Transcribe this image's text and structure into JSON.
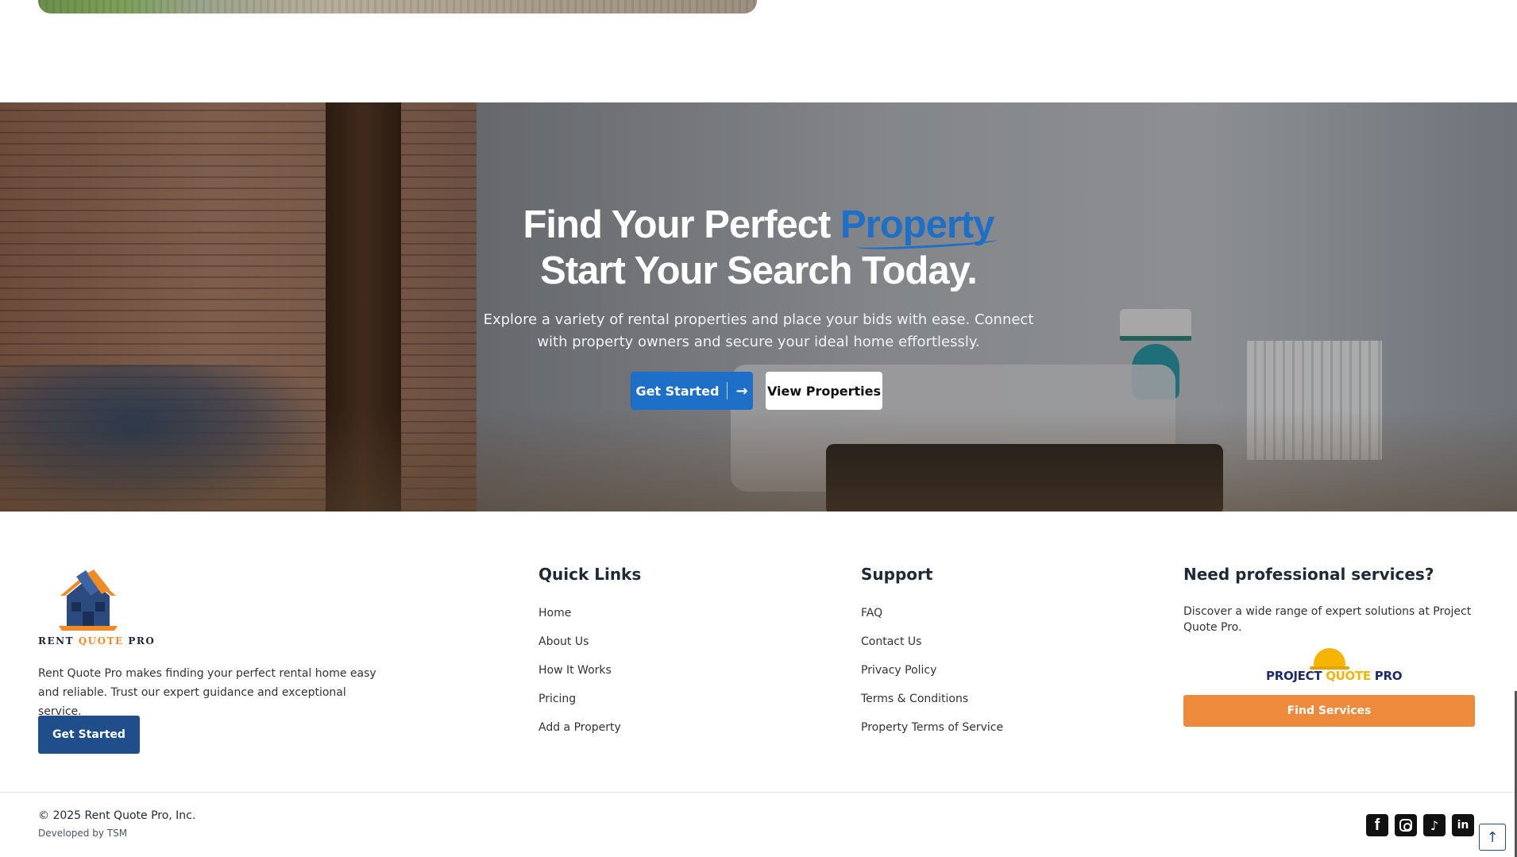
{
  "hero": {
    "title_part1": "Find Your Perfect ",
    "title_accent": "Property",
    "title_line2": "Start Your Search Today.",
    "description": "Explore a variety of rental properties and place your bids with ease. Connect with property owners and secure your ideal home effortlessly.",
    "primary_button": "Get Started",
    "primary_icon": "→",
    "secondary_button": "View Properties"
  },
  "footer": {
    "brand_part1": "RENT ",
    "brand_part2": "QUOTE",
    "brand_part3": " PRO",
    "about": "Rent Quote Pro makes finding your perfect rental home easy and reliable. Trust our expert guidance and exceptional service.",
    "cta": "Get Started",
    "quick_links": {
      "heading": "Quick Links",
      "items": [
        "Home",
        "About Us",
        "How It Works",
        "Pricing",
        "Add a Property"
      ]
    },
    "support": {
      "heading": "Support",
      "items": [
        "FAQ",
        "Contact Us",
        "Privacy Policy",
        "Terms & Conditions",
        "Property Terms of Service"
      ]
    },
    "services": {
      "heading": "Need professional services?",
      "text": "Discover a wide range of expert solutions at Project Quote Pro.",
      "logo_part1": "PROJECT ",
      "logo_part2": "QUOTE",
      "logo_part3": " PRO",
      "button": "Find Services"
    },
    "copyright": "© 2025 Rent Quote Pro, Inc.",
    "developed_by": "Developed by TSM",
    "socials": {
      "facebook": "f",
      "tiktok": "♪",
      "linkedin": "in"
    },
    "back_to_top": "↑"
  },
  "colors": {
    "accent_blue": "#1e6fc7",
    "navy": "#1f4e8a",
    "orange": "#ee8a3c"
  }
}
